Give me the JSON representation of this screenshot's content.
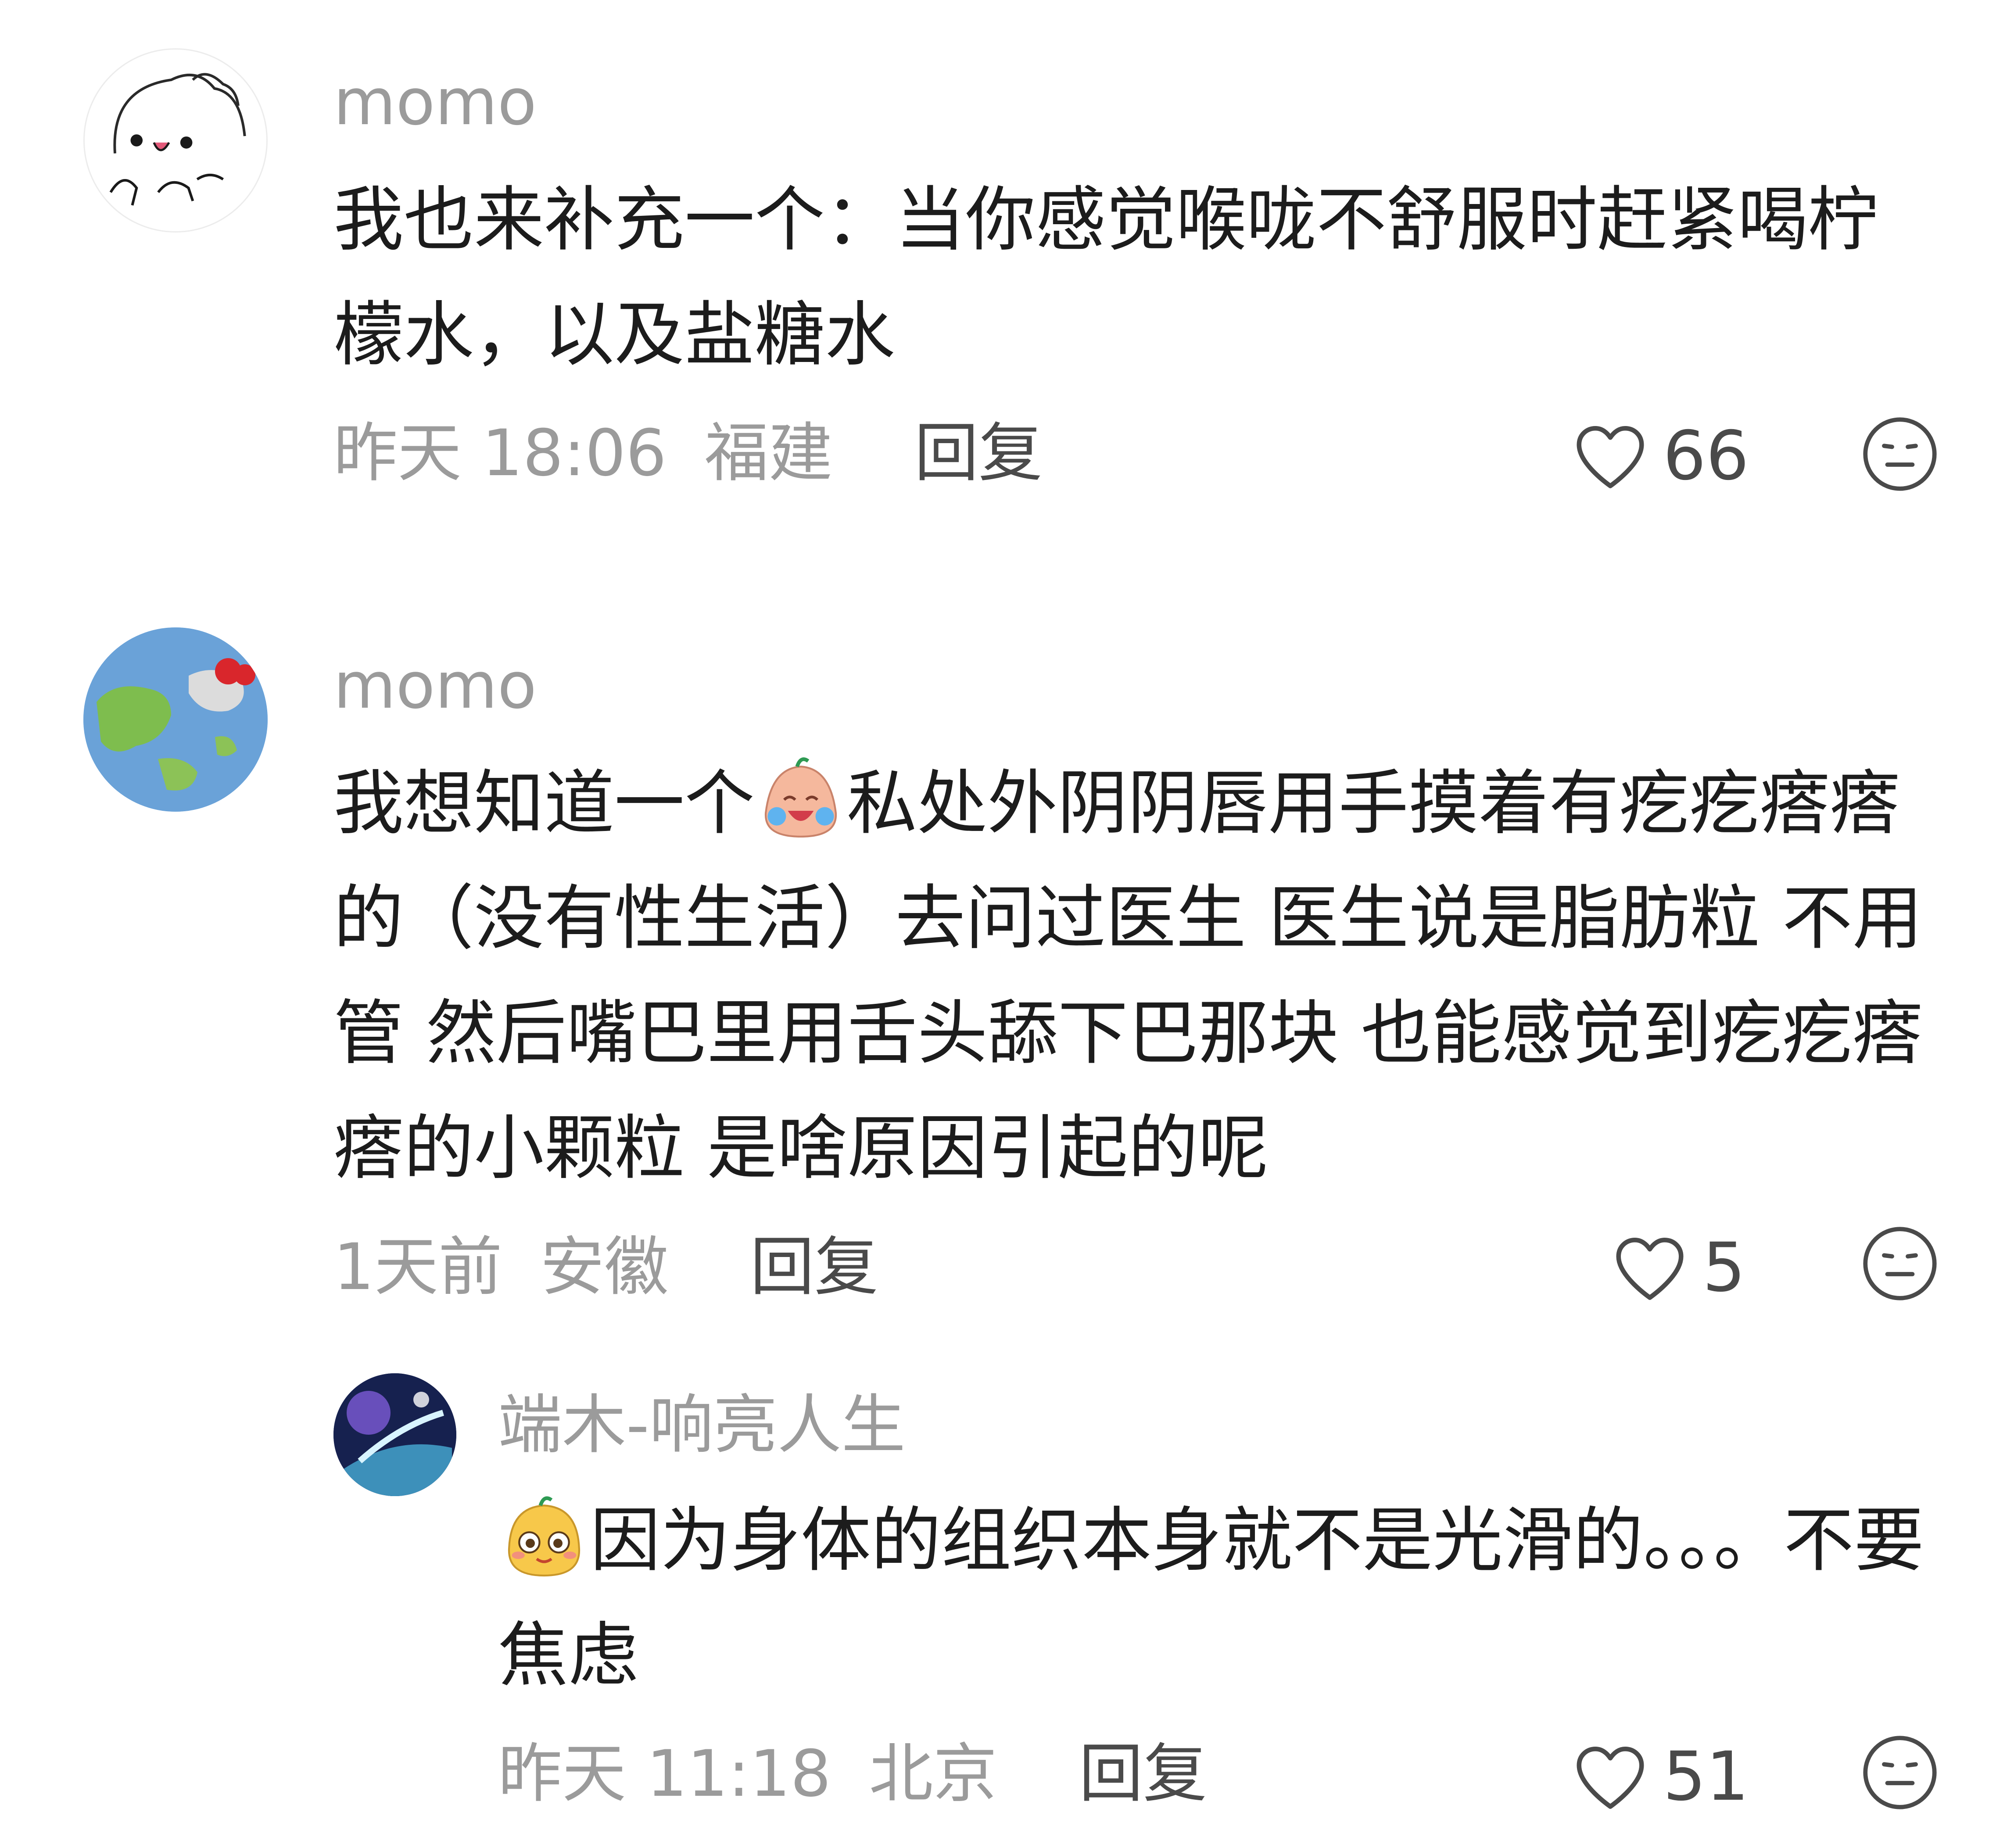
{
  "comments": [
    {
      "username": "momo",
      "text": "我也来补充一个：当你感觉喉咙不舒服时赶紧喝柠檬水，以及盐糖水",
      "time": "昨天 18:06",
      "location": "福建",
      "reply_label": "回复",
      "likes": "66",
      "avatar_icon": "cartoon-bun-avatar"
    },
    {
      "username": "momo",
      "text_before_emoji": "我想知道一个",
      "emoji": "crying-laughing-face-emoji",
      "text_after_emoji": "私处外阴阴唇用手摸着有疙疙瘩瘩的（没有性生活）去问过医生 医生说是脂肪粒 不用管 然后嘴巴里用舌头舔下巴那块 也能感觉到疙疙瘩瘩的小颗粒 是啥原因引起的呢",
      "time": "1天前",
      "location": "安徽",
      "reply_label": "回复",
      "likes": "5",
      "avatar_icon": "globe-hello-kitty-avatar"
    }
  ],
  "reply": {
    "username": "端木-响亮人生",
    "emoji": "shy-face-emoji",
    "text": "因为身体的组织本身就不是光滑的。。。不要焦虑",
    "time": "昨天 11:18",
    "location": "北京",
    "reply_label": "回复",
    "likes": "51",
    "avatar_icon": "galaxy-avatar"
  },
  "colors": {
    "muted": "#9b9b9b",
    "text": "#1c1c1c",
    "action": "#4a4a4a"
  }
}
